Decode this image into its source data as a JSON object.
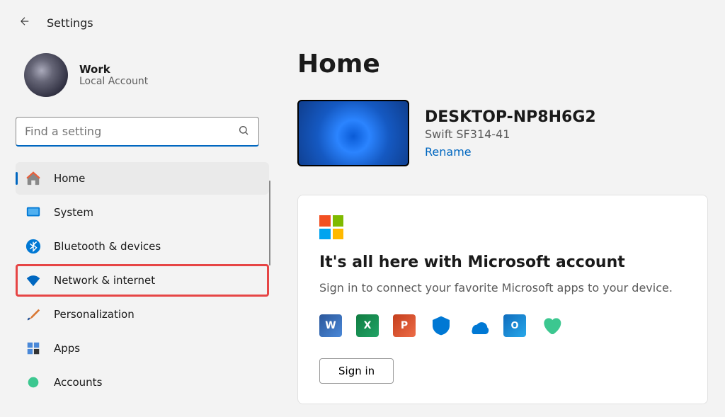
{
  "header": {
    "title": "Settings"
  },
  "account": {
    "name": "Work",
    "type": "Local Account"
  },
  "search": {
    "placeholder": "Find a setting"
  },
  "nav": {
    "items": [
      {
        "label": "Home",
        "icon": "home",
        "selected": true
      },
      {
        "label": "System",
        "icon": "system",
        "selected": false
      },
      {
        "label": "Bluetooth & devices",
        "icon": "bluetooth",
        "selected": false
      },
      {
        "label": "Network & internet",
        "icon": "wifi",
        "selected": false,
        "highlighted": true
      },
      {
        "label": "Personalization",
        "icon": "brush",
        "selected": false
      },
      {
        "label": "Apps",
        "icon": "apps",
        "selected": false
      },
      {
        "label": "Accounts",
        "icon": "accounts",
        "selected": false
      }
    ]
  },
  "page": {
    "title": "Home"
  },
  "device": {
    "name": "DESKTOP-NP8H6G2",
    "model": "Swift SF314-41",
    "rename_label": "Rename"
  },
  "ms_card": {
    "title": "It's all here with Microsoft account",
    "description": "Sign in to connect your favorite Microsoft apps to your device.",
    "signin_label": "Sign in",
    "app_icons": [
      "word",
      "excel",
      "powerpoint",
      "defender",
      "onedrive",
      "outlook",
      "family"
    ]
  }
}
